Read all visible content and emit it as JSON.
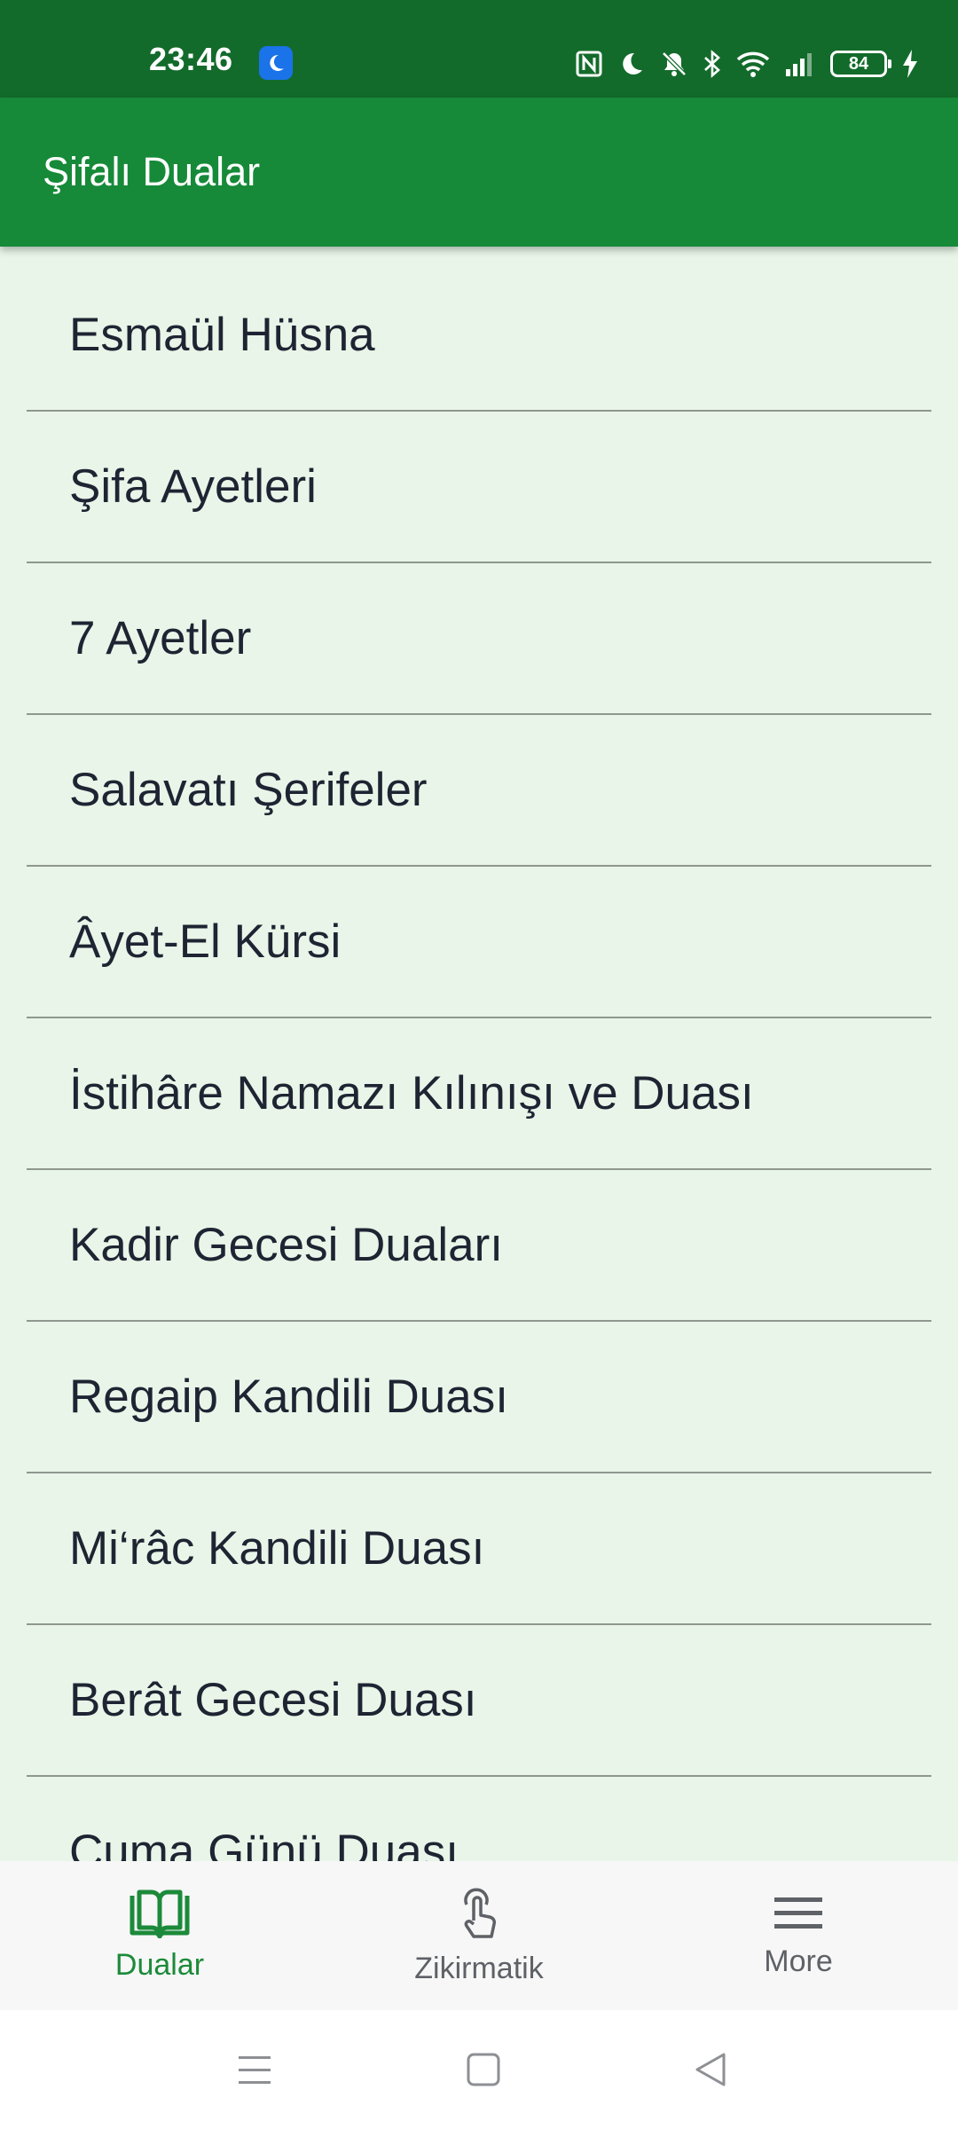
{
  "status_bar": {
    "time": "23:46",
    "battery_level": "84",
    "icons": [
      "moon-badge-icon",
      "nfc-icon",
      "do-not-disturb-icon",
      "notifications-muted-icon",
      "bluetooth-icon",
      "wifi-icon",
      "signal-icon",
      "battery-icon",
      "charging-icon"
    ]
  },
  "app_bar": {
    "title": "Şifalı Dualar",
    "color": "#168a38"
  },
  "list": {
    "items": [
      "Esmaül Hüsna",
      "Şifa Ayetleri",
      "7 Ayetler",
      "Salavatı Şerifeler",
      "Âyet-El Kürsi",
      "İstihâre Namazı Kılınışı ve Duası",
      "Kadir Gecesi Duaları",
      "Regaip Kandili Duası",
      "Mi‘râc Kandili Duası",
      "Berât Gecesi Duası",
      "Cuma Günü Duası"
    ]
  },
  "bottom_nav": {
    "tabs": [
      {
        "label": "Dualar",
        "icon": "open-book-icon",
        "active": true
      },
      {
        "label": "Zikirmatik",
        "icon": "tap-hand-icon",
        "active": false
      },
      {
        "label": "More",
        "icon": "menu-icon",
        "active": false
      }
    ],
    "active_color": "#1c8a3a"
  },
  "system_nav": {
    "buttons": [
      "recents-button",
      "home-button",
      "back-button"
    ]
  }
}
